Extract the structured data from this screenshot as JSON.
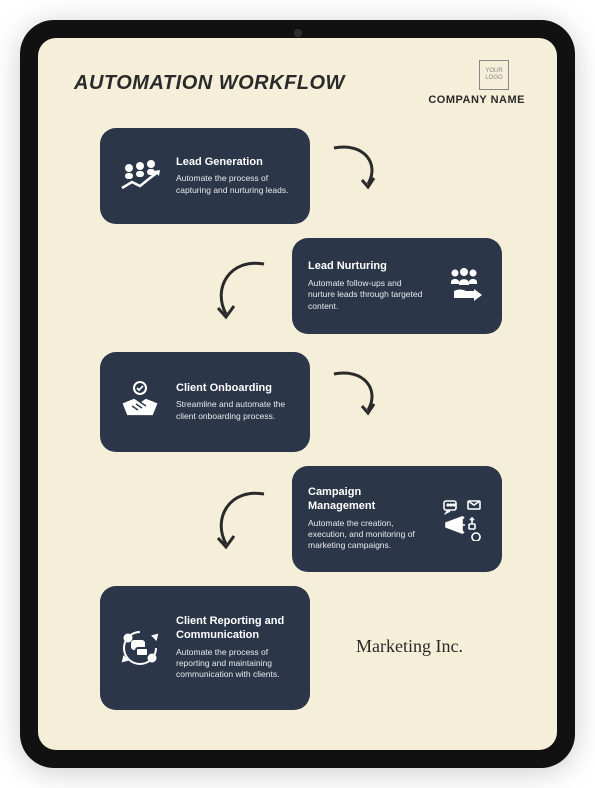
{
  "header": {
    "title": "AUTOMATION WORKFLOW",
    "logo_placeholder": "YOUR LOGO",
    "company_name": "COMPANY NAME"
  },
  "steps": [
    {
      "title": "Lead Generation",
      "desc": "Automate the process of capturing and nurturing leads.",
      "icon": "lead-generation-icon"
    },
    {
      "title": "Lead Nurturing",
      "desc": "Automate follow-ups and nurture leads through targeted content.",
      "icon": "lead-nurturing-icon"
    },
    {
      "title": "Client Onboarding",
      "desc": "Streamline and automate the client onboarding process.",
      "icon": "client-onboarding-icon"
    },
    {
      "title": "Campaign Management",
      "desc": "Automate the creation, execution, and monitoring of marketing campaigns.",
      "icon": "campaign-management-icon"
    },
    {
      "title": "Client Reporting and Communication",
      "desc": "Automate the process of reporting and maintaining communication with clients.",
      "icon": "client-reporting-icon"
    }
  ],
  "footer": {
    "brand": "Marketing Inc."
  },
  "colors": {
    "card_bg": "#2b3649",
    "screen_bg": "#f5efda",
    "stroke": "#2a2a2a"
  }
}
